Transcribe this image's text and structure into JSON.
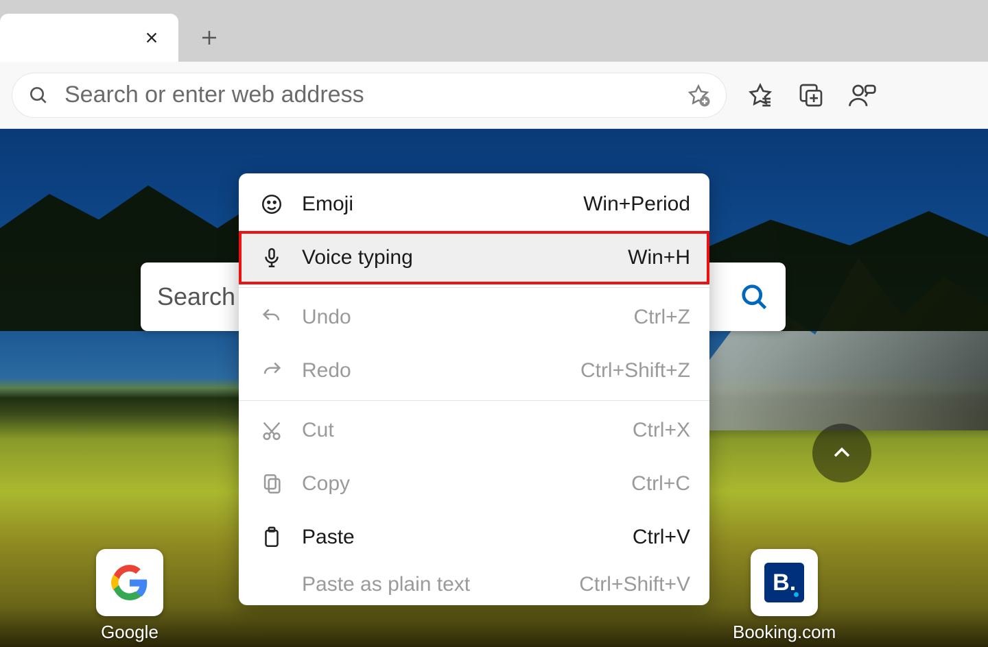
{
  "tabstrip": {},
  "omnibox": {
    "placeholder": "Search or enter web address"
  },
  "center_search": {
    "placeholder": "Search"
  },
  "tiles": {
    "google": {
      "label": "Google"
    },
    "booking": {
      "label": "Booking.com",
      "badge": "B."
    }
  },
  "context_menu": {
    "emoji": {
      "label": "Emoji",
      "shortcut": "Win+Period"
    },
    "voice_typing": {
      "label": "Voice typing",
      "shortcut": "Win+H",
      "highlighted": true
    },
    "undo": {
      "label": "Undo",
      "shortcut": "Ctrl+Z"
    },
    "redo": {
      "label": "Redo",
      "shortcut": "Ctrl+Shift+Z"
    },
    "cut": {
      "label": "Cut",
      "shortcut": "Ctrl+X"
    },
    "copy": {
      "label": "Copy",
      "shortcut": "Ctrl+C"
    },
    "paste": {
      "label": "Paste",
      "shortcut": "Ctrl+V"
    },
    "paste_plain": {
      "label": "Paste as plain text",
      "shortcut": "Ctrl+Shift+V"
    }
  }
}
